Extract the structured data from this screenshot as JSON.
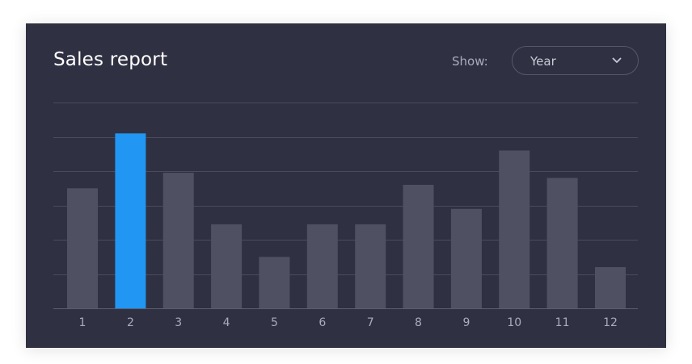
{
  "header": {
    "title": "Sales report",
    "show_label": "Show:",
    "period_select": {
      "value": "Year",
      "icon": "chevron-down-icon"
    }
  },
  "colors": {
    "card_background": "#2f3142",
    "bar_default": "#4f5163",
    "bar_highlight": "#2196f3",
    "gridline": "#4a4c5e",
    "tick_label": "#a9acbc"
  },
  "chart_data": {
    "type": "bar",
    "title": "Sales report",
    "xlabel": "",
    "ylabel": "",
    "categories": [
      "1",
      "2",
      "3",
      "4",
      "5",
      "6",
      "7",
      "8",
      "9",
      "10",
      "11",
      "12"
    ],
    "values": [
      3.5,
      5.1,
      3.95,
      2.45,
      1.5,
      2.45,
      2.45,
      3.6,
      2.9,
      4.6,
      3.8,
      1.2
    ],
    "highlighted_category": "2",
    "ylim": [
      0,
      6
    ],
    "y_gridlines": [
      0,
      1,
      2,
      3,
      4,
      5,
      6
    ],
    "y_tick_labels_shown": false,
    "grid": true,
    "legend": "none"
  }
}
